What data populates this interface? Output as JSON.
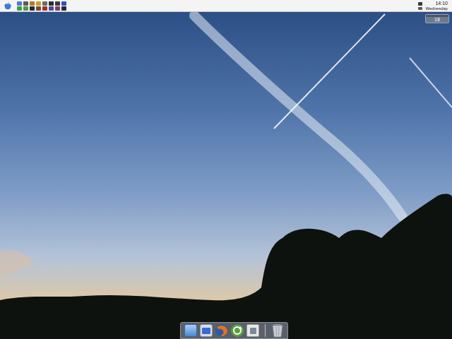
{
  "menu_bar": {
    "tray_rows": [
      [
        {
          "color": "#4a7bd0"
        },
        {
          "color": "#5a5a5a"
        },
        {
          "color": "#b07a2a"
        },
        {
          "color": "#c8a030"
        },
        {
          "color": "#6a6a6a"
        },
        {
          "color": "#2a2a2a"
        },
        {
          "color": "#3a3a3a"
        },
        {
          "color": "#3050c0"
        }
      ],
      [
        {
          "color": "#3aa040"
        },
        {
          "color": "#4a9a4a"
        },
        {
          "color": "#2a2a2a"
        },
        {
          "color": "#7a4a2a"
        },
        {
          "color": "#a03030"
        },
        {
          "color": "#4a4a8a"
        },
        {
          "color": "#7a3a7a"
        },
        {
          "color": "#2a2a2a"
        }
      ]
    ],
    "time": "14:10",
    "day": "Wednesday"
  },
  "date_widget": {
    "day_number": "18"
  },
  "dock": {
    "items": [
      {
        "kind": "finder"
      },
      {
        "kind": "mac"
      },
      {
        "kind": "firefox"
      },
      {
        "kind": "sync"
      },
      {
        "kind": "preview"
      },
      {
        "kind": "trash"
      }
    ]
  }
}
